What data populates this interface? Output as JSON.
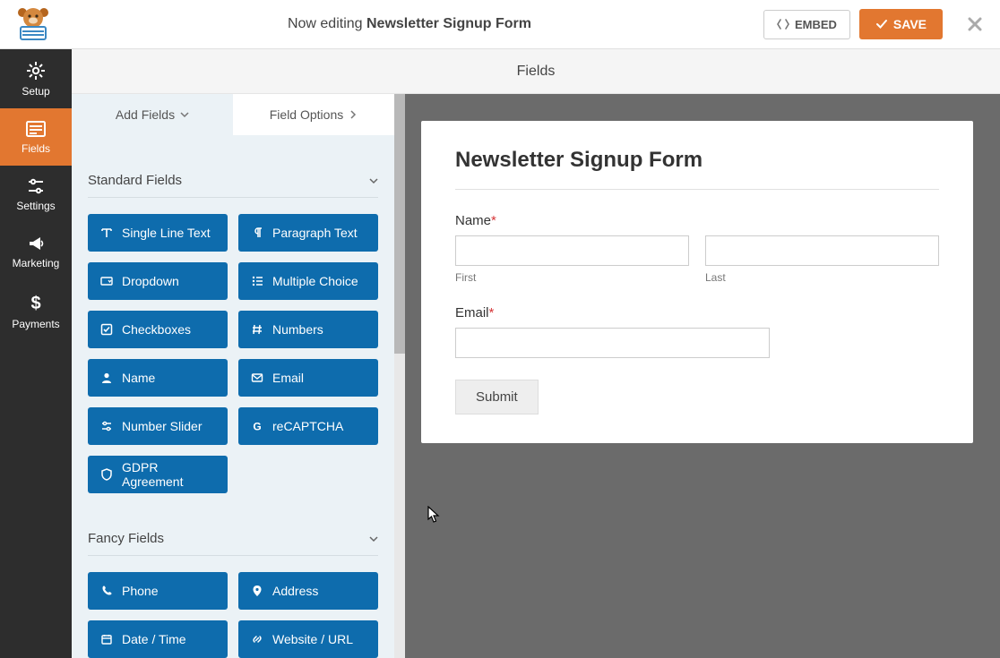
{
  "topbar": {
    "now_editing_prefix": "Now editing ",
    "form_name": "Newsletter Signup Form",
    "embed_label": "EMBED",
    "save_label": "SAVE"
  },
  "sidenav": {
    "setup": "Setup",
    "fields": "Fields",
    "settings": "Settings",
    "marketing": "Marketing",
    "payments": "Payments"
  },
  "builder_header": "Fields",
  "panel_tabs": {
    "add_fields": "Add Fields",
    "field_options": "Field Options"
  },
  "sections": {
    "standard": {
      "title": "Standard Fields",
      "items": [
        {
          "icon": "text-icon",
          "label": "Single Line Text"
        },
        {
          "icon": "paragraph-icon",
          "label": "Paragraph Text"
        },
        {
          "icon": "dropdown-icon",
          "label": "Dropdown"
        },
        {
          "icon": "list-icon",
          "label": "Multiple Choice"
        },
        {
          "icon": "check-square-icon",
          "label": "Checkboxes"
        },
        {
          "icon": "hashtag-icon",
          "label": "Numbers"
        },
        {
          "icon": "user-icon",
          "label": "Name"
        },
        {
          "icon": "envelope-icon",
          "label": "Email"
        },
        {
          "icon": "sliders-icon",
          "label": "Number Slider"
        },
        {
          "icon": "google-icon",
          "label": "reCAPTCHA"
        },
        {
          "icon": "shield-icon",
          "label": "GDPR Agreement"
        }
      ]
    },
    "fancy": {
      "title": "Fancy Fields",
      "items": [
        {
          "icon": "phone-icon",
          "label": "Phone"
        },
        {
          "icon": "map-marker-icon",
          "label": "Address"
        },
        {
          "icon": "calendar-icon",
          "label": "Date / Time"
        },
        {
          "icon": "link-icon",
          "label": "Website / URL"
        }
      ]
    }
  },
  "preview": {
    "title": "Newsletter Signup Form",
    "name_label": "Name",
    "first_sub": "First",
    "last_sub": "Last",
    "email_label": "Email",
    "submit": "Submit"
  },
  "colors": {
    "accent": "#e27730",
    "field_btn": "#0e6cad"
  }
}
